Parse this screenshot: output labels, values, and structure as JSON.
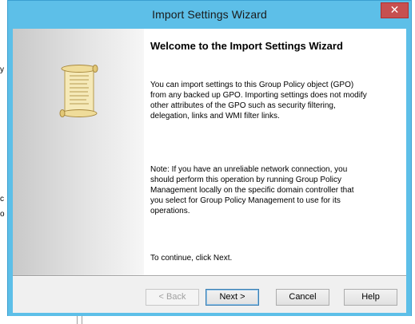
{
  "window": {
    "title": "Import Settings Wizard",
    "close_glyph": "✕"
  },
  "wizard": {
    "heading": "Welcome to the Import Settings Wizard",
    "paragraph1": "You can import settings to this Group Policy object (GPO) from any backed up GPO. Importing settings does not modify other attributes of the GPO such as security filtering, delegation, links and WMI filter links.",
    "paragraph2": "Note: If you have an unreliable network connection, you should perform this operation by running Group Policy Management locally on the specific domain controller that you select for Group Policy Management to use for its operations.",
    "paragraph3": "To continue, click Next.",
    "icon": "scroll-icon"
  },
  "buttons": {
    "back": "< Back",
    "next": "Next >",
    "cancel": "Cancel",
    "help": "Help"
  },
  "background_fragments": {
    "left_y": "y",
    "left_c": "c",
    "left_o": "o"
  },
  "colors": {
    "title_bar": "#5dbfe8",
    "close_button": "#c75050",
    "dialog_bg": "#f0f0f0"
  }
}
